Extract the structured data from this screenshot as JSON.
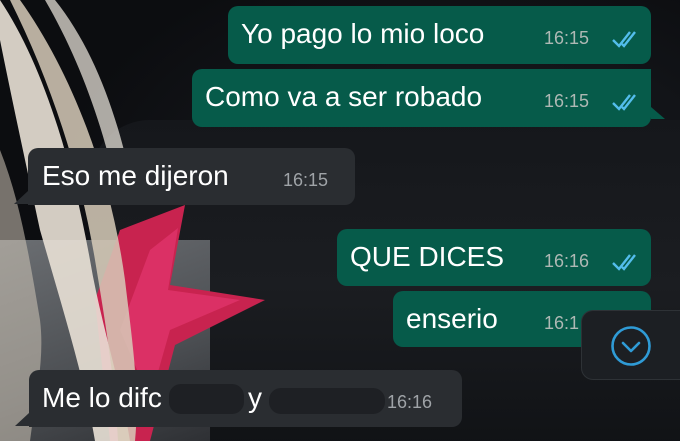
{
  "messages": [
    {
      "id": "m1",
      "direction": "outgoing",
      "text": "Yo pago lo mio loco",
      "time": "16:15",
      "status": "read-ticks-icon"
    },
    {
      "id": "m2",
      "direction": "outgoing",
      "text": "Como va a ser robado",
      "time": "16:15",
      "status": "read-ticks-icon"
    },
    {
      "id": "m3",
      "direction": "incoming",
      "text": "Eso me dijeron",
      "time": "16:15"
    },
    {
      "id": "m4",
      "direction": "outgoing",
      "text": "QUE DICES",
      "time": "16:16",
      "status": "read-ticks-icon"
    },
    {
      "id": "m5",
      "direction": "outgoing",
      "text": "enserio",
      "time": "16:1"
    },
    {
      "id": "m6",
      "direction": "incoming",
      "text": "Me lo difc",
      "text_after": "y",
      "time": "16:16"
    }
  ],
  "scroll_button": {
    "icon": "chevron-down-circle-icon"
  },
  "colors": {
    "outgoing_bubble": "#065b4a",
    "incoming_bubble": "#2a2d31",
    "tick_blue": "#53bdeb",
    "scroll_accent": "#2f9bd6"
  }
}
